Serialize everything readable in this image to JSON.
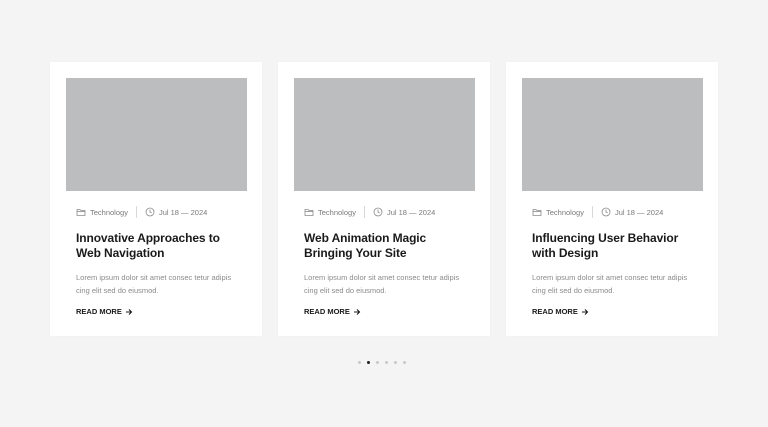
{
  "cards": [
    {
      "category": "Technology",
      "date": "Jul 18 — 2024",
      "title": "Innovative Approaches to Web Navigation",
      "excerpt": "Lorem ipsum dolor sit amet consec tetur adipis cing elit sed do eiusmod.",
      "read_more": "READ MORE"
    },
    {
      "category": "Technology",
      "date": "Jul 18 — 2024",
      "title": "Web Animation Magic Bringing Your Site",
      "excerpt": "Lorem ipsum dolor sit amet consec tetur adipis cing elit sed do eiusmod.",
      "read_more": "READ MORE"
    },
    {
      "category": "Technology",
      "date": "Jul 18 — 2024",
      "title": "Influencing User Behavior with Design",
      "excerpt": "Lorem ipsum dolor sit amet consec tetur adipis cing elit sed do eiusmod.",
      "read_more": "READ MORE"
    }
  ],
  "pagination": {
    "total": 6,
    "active_index": 1
  },
  "icons": {
    "category": "folder-icon",
    "date": "clock-icon",
    "read_more": "arrow-right-icon"
  },
  "colors": {
    "background": "#f4f4f4",
    "card": "#ffffff",
    "thumbnail_placeholder": "#bcbdbf",
    "title": "#1a1a1a",
    "muted": "#8b8b8b",
    "dot_active": "#222222",
    "dot_inactive": "#c9c9c9"
  }
}
